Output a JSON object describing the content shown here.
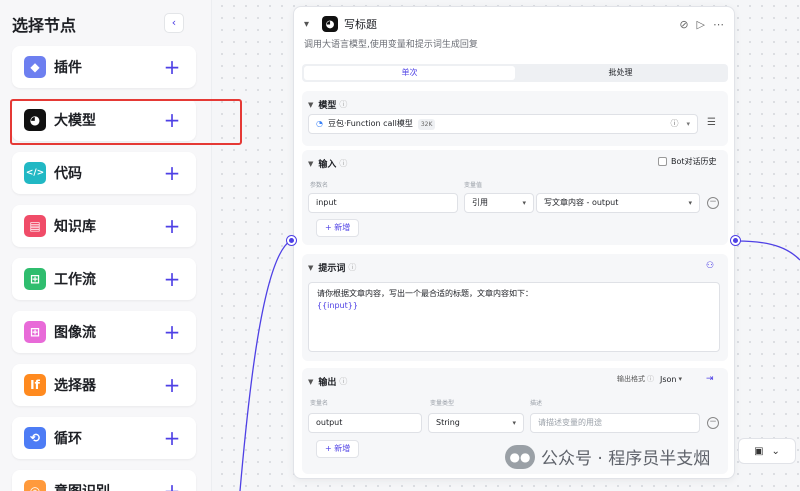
{
  "sidebar": {
    "title": "选择节点",
    "collapse_icon": "‹",
    "items": [
      {
        "label": "插件",
        "icon": "cube-icon",
        "glyph": "◆",
        "color": "#6d7ff0",
        "plus": "+"
      },
      {
        "label": "大模型",
        "icon": "llm-ghost-icon",
        "glyph": "◕",
        "color": "#111111",
        "plus": "+"
      },
      {
        "label": "代码",
        "icon": "code-icon",
        "glyph": "</>",
        "color": "#21b8c4",
        "plus": "+"
      },
      {
        "label": "知识库",
        "icon": "knowledge-icon",
        "glyph": "▤",
        "color": "#f04c68",
        "plus": "+"
      },
      {
        "label": "工作流",
        "icon": "workflow-icon",
        "glyph": "⊞",
        "color": "#2fbd6e",
        "plus": "+"
      },
      {
        "label": "图像流",
        "icon": "imageflow-icon",
        "glyph": "⊞",
        "color": "#e86ad8",
        "plus": "+"
      },
      {
        "label": "选择器",
        "icon": "selector-icon",
        "glyph": "If",
        "color": "#ff8a1f",
        "plus": "+"
      },
      {
        "label": "循环",
        "icon": "loop-icon",
        "glyph": "⟲",
        "color": "#4d7cf5",
        "plus": "+"
      },
      {
        "label": "意图识别",
        "icon": "intent-icon",
        "glyph": "◎",
        "color": "#ff9a3c",
        "plus": "+"
      }
    ]
  },
  "node": {
    "title": "写标题",
    "description": "调用大语言模型,使用变量和提示词生成回复",
    "actions": [
      "⊘",
      "▷",
      "⋯"
    ],
    "tabs": [
      {
        "label": "单次",
        "active": true
      },
      {
        "label": "批处理",
        "active": false
      }
    ]
  },
  "model": {
    "header": "模型",
    "name": "豆包·Function call模型",
    "badge": "32K",
    "info_glyph": "ⓘ",
    "settings_glyph": "☰"
  },
  "input": {
    "header": "输入",
    "checkbox_label": "Bot对话历史",
    "col_param": "参数名",
    "col_value": "变量值",
    "param_value": "input",
    "ref_type": "引用",
    "ref_value": "写文章内容 - output",
    "add_label": "+ 新增"
  },
  "prompt": {
    "header": "提示词",
    "text": "请你根据文章内容，写出一个最合适的标题，文章内容如下：",
    "var": "{{input}}"
  },
  "output": {
    "header": "输出",
    "format_label": "输出格式",
    "format_value": "Json",
    "col_name": "变量名",
    "col_type": "变量类型",
    "col_desc": "描述",
    "name_value": "output",
    "type_value": "String",
    "desc_placeholder": "请描述变量的用途",
    "add_label": "+ 新增"
  },
  "watermark": {
    "text": "公众号 · 程序员半支烟"
  }
}
